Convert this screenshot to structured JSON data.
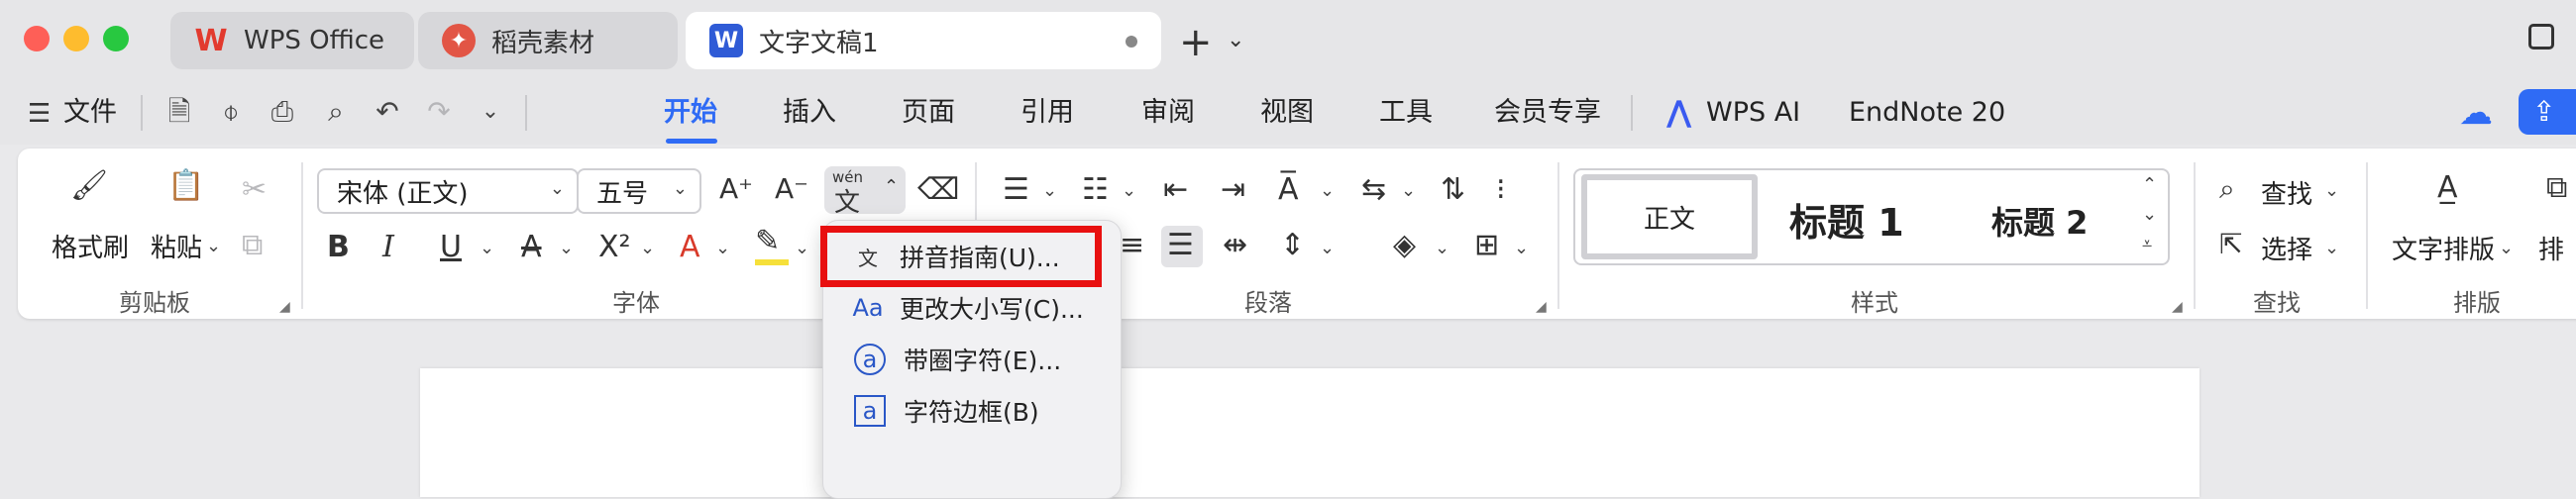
{
  "tabs": [
    {
      "label": "WPS Office",
      "icon": "wps-logo-icon"
    },
    {
      "label": "稻壳素材",
      "icon": "docer-icon"
    },
    {
      "label": "文字文稿1",
      "icon": "writer-icon",
      "active": true
    }
  ],
  "menubar": {
    "file_label": "文件",
    "items": [
      "开始",
      "插入",
      "页面",
      "引用",
      "审阅",
      "视图",
      "工具",
      "会员专享"
    ],
    "active_item": "开始",
    "wps_ai_label": "WPS AI",
    "endnote_label": "EndNote 20"
  },
  "ribbon": {
    "clipboard": {
      "format_painter_label": "格式刷",
      "paste_label": "粘贴",
      "group_label": "剪贴板"
    },
    "font": {
      "font_name": "宋体 (正文)",
      "font_size": "五号",
      "group_label": "字体",
      "pinyin_icon_text": "wén",
      "pinyin_char": "文"
    },
    "paragraph": {
      "group_label": "段落"
    },
    "styles": {
      "normal_label": "正文",
      "heading1_label": "标题 1",
      "heading2_label": "标题 2",
      "group_label": "样式"
    },
    "find": {
      "find_label": "查找",
      "select_label": "选择",
      "group_label": "查找"
    },
    "layout": {
      "text_layout_label": "文字排版",
      "arrange_label": "排",
      "group_label": "排版"
    }
  },
  "dropdown": {
    "items": [
      {
        "label": "拼音指南(U)...",
        "icon": "pinyin-icon",
        "highlighted": true
      },
      {
        "label": "更改大小写(C)...",
        "icon": "change-case-icon"
      },
      {
        "label": "带圈字符(E)...",
        "icon": "enclosed-char-icon"
      },
      {
        "label": "字符边框(B)",
        "icon": "char-border-icon"
      }
    ]
  },
  "colors": {
    "accent": "#2f6bf5",
    "highlight_border": "#e81010",
    "wps_red": "#e23a2e"
  }
}
